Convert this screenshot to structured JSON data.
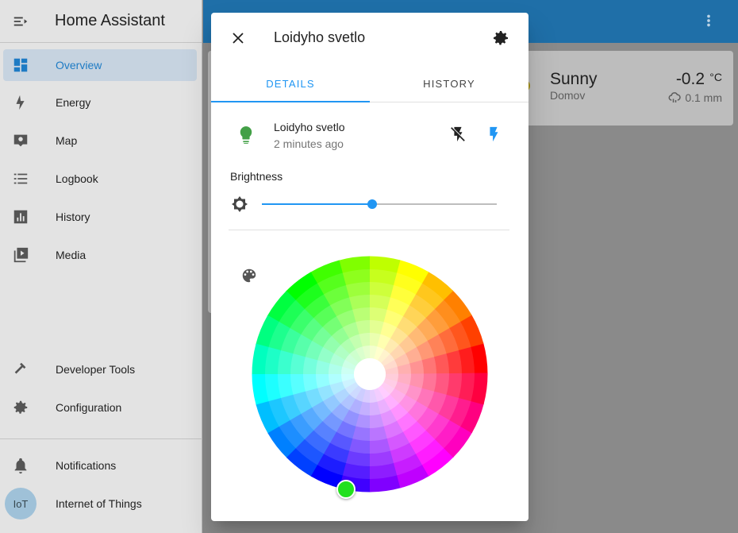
{
  "app": {
    "title": "Home Assistant"
  },
  "sidebar": {
    "items": [
      {
        "label": "Overview",
        "icon": "dashboard-icon"
      },
      {
        "label": "Energy",
        "icon": "lightning-bolt-icon"
      },
      {
        "label": "Map",
        "icon": "map-icon"
      },
      {
        "label": "Logbook",
        "icon": "list-icon"
      },
      {
        "label": "History",
        "icon": "chart-box-icon"
      },
      {
        "label": "Media",
        "icon": "play-box-icon"
      }
    ],
    "bottom_items": [
      {
        "label": "Developer Tools",
        "icon": "hammer-icon"
      },
      {
        "label": "Configuration",
        "icon": "cog-icon"
      }
    ],
    "notifications": {
      "label": "Notifications",
      "icon": "bell-icon"
    },
    "user": {
      "label": "Internet of Things",
      "initials": "IoT"
    }
  },
  "weather": {
    "condition": "Sunny",
    "location": "Domov",
    "temperature": "-0.2",
    "unit": "°C",
    "precipitation": "0.1 mm"
  },
  "dialog": {
    "title": "Loidyho svetlo",
    "tabs": [
      "DETAILS",
      "HISTORY"
    ],
    "entity": {
      "name": "Loidyho svetlo",
      "last_changed": "2 minutes ago"
    },
    "brightness": {
      "label": "Brightness",
      "value_percent": 47
    },
    "color": {
      "selected": "#22e01d"
    }
  },
  "colors": {
    "accent": "#2196f3",
    "bulb_on": "#43a047",
    "topbar": "#1f6fa8"
  }
}
